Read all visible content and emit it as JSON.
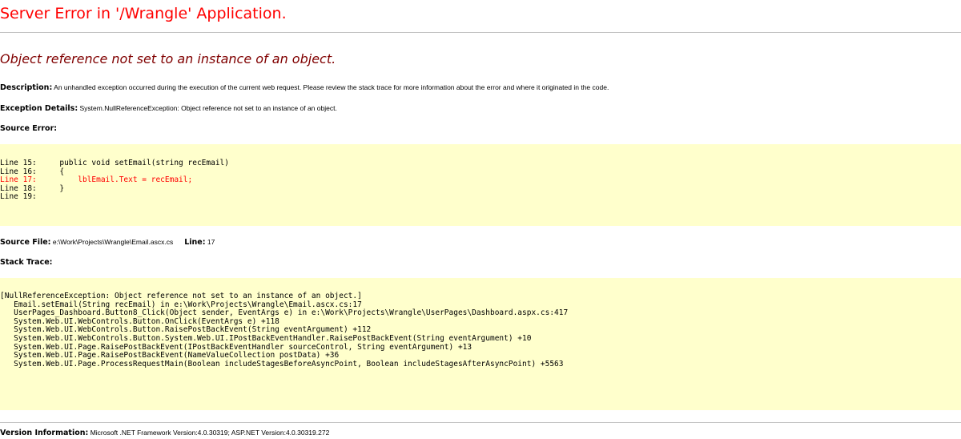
{
  "page": {
    "title": "Server Error in '/Wrangle' Application.",
    "exception_message": "Object reference not set to an instance of an object."
  },
  "description": {
    "label": "Description:",
    "text": "An unhandled exception occurred during the execution of the current web request. Please review the stack trace for more information about the error and where it originated in the code."
  },
  "exception_details": {
    "label": "Exception Details:",
    "text": "System.NullReferenceException: Object reference not set to an instance of an object."
  },
  "source_error": {
    "heading": "Source Error:",
    "lines": [
      {
        "text": "Line 15:     public void setEmail(string recEmail)",
        "error": false
      },
      {
        "text": "Line 16:     {",
        "error": false
      },
      {
        "text": "Line 17:         lblEmail.Text = recEmail;",
        "error": true
      },
      {
        "text": "Line 18:     }",
        "error": false
      },
      {
        "text": "Line 19:",
        "error": false
      }
    ]
  },
  "source_file": {
    "label": "Source File:",
    "path": "e:\\Work\\Projects\\Wrangle\\Email.ascx.cs",
    "line_label": "Line:",
    "line_number": "17"
  },
  "stack_trace": {
    "heading": "Stack Trace:",
    "lines": [
      "[NullReferenceException: Object reference not set to an instance of an object.]",
      "   Email.setEmail(String recEmail) in e:\\Work\\Projects\\Wrangle\\Email.ascx.cs:17",
      "   UserPages_Dashboard.Button8_Click(Object sender, EventArgs e) in e:\\Work\\Projects\\Wrangle\\UserPages\\Dashboard.aspx.cs:417",
      "   System.Web.UI.WebControls.Button.OnClick(EventArgs e) +118",
      "   System.Web.UI.WebControls.Button.RaisePostBackEvent(String eventArgument) +112",
      "   System.Web.UI.WebControls.Button.System.Web.UI.IPostBackEventHandler.RaisePostBackEvent(String eventArgument) +10",
      "   System.Web.UI.Page.RaisePostBackEvent(IPostBackEventHandler sourceControl, String eventArgument) +13",
      "   System.Web.UI.Page.RaisePostBackEvent(NameValueCollection postData) +36",
      "   System.Web.UI.Page.ProcessRequestMain(Boolean includeStagesBeforeAsyncPoint, Boolean includeStagesAfterAsyncPoint) +5563"
    ]
  },
  "version_info": {
    "label": "Version Information:",
    "text": "Microsoft .NET Framework Version:4.0.30319; ASP.NET Version:4.0.30319.272"
  },
  "colors": {
    "title": "#ff0000",
    "exception": "#800000",
    "code_background": "#ffffcc",
    "error_line": "#ff0000",
    "rule": "#c0c0c0"
  }
}
